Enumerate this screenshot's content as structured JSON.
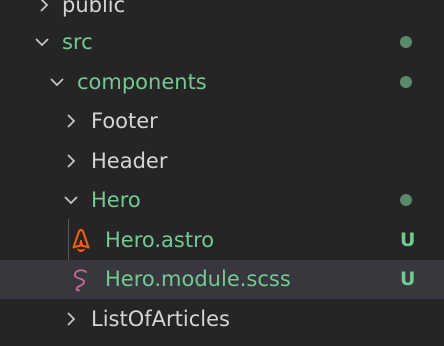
{
  "explorer": {
    "items": [
      {
        "label": "public",
        "kind": "folder",
        "state": "collapsed",
        "git": null,
        "icon": "chevron-right-icon"
      },
      {
        "label": "src",
        "kind": "folder",
        "state": "expanded",
        "git": "modified-dot",
        "icon": "chevron-down-icon"
      },
      {
        "label": "components",
        "kind": "folder",
        "state": "expanded",
        "git": "modified-dot",
        "icon": "chevron-down-icon"
      },
      {
        "label": "Footer",
        "kind": "folder",
        "state": "collapsed",
        "git": null,
        "icon": "chevron-right-icon"
      },
      {
        "label": "Header",
        "kind": "folder",
        "state": "collapsed",
        "git": null,
        "icon": "chevron-right-icon"
      },
      {
        "label": "Hero",
        "kind": "folder",
        "state": "expanded",
        "git": "modified-dot",
        "icon": "chevron-down-icon"
      },
      {
        "label": "Hero.astro",
        "kind": "file",
        "git": "U",
        "icon": "astro-file-icon"
      },
      {
        "label": "Hero.module.scss",
        "kind": "file",
        "git": "U",
        "icon": "sass-file-icon",
        "selected": true
      },
      {
        "label": "ListOfArticles",
        "kind": "folder",
        "state": "collapsed",
        "git": null,
        "icon": "chevron-right-icon"
      }
    ]
  },
  "colors": {
    "background": "#252526",
    "selected_row": "#37373d",
    "git_green": "#73c991",
    "text": "#d4d4d4",
    "astro_orange": "#ff5d01",
    "sass_pink": "#cd6799"
  }
}
